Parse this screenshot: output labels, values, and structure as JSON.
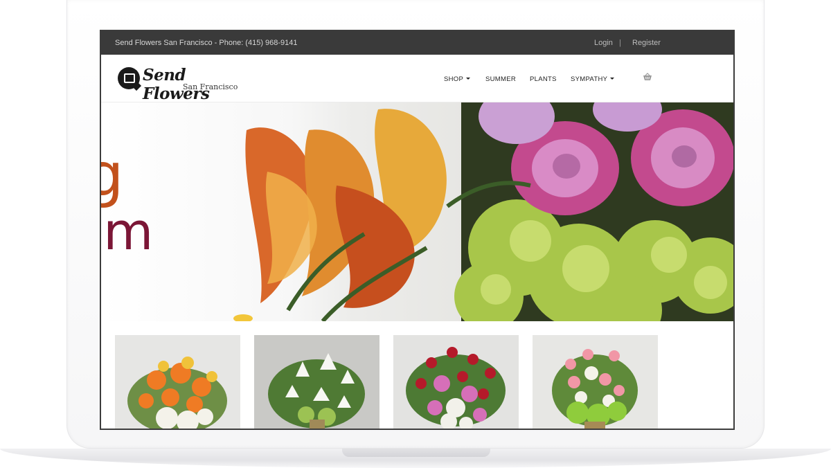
{
  "topbar": {
    "phone_text": "Send Flowers San Francisco - Phone: (415) 968-9141",
    "login": "Login",
    "separator": "|",
    "register": "Register"
  },
  "logo": {
    "title": "Send Flowers",
    "subtitle": "San Francisco"
  },
  "nav": {
    "items": [
      {
        "label": "SHOP",
        "has_dropdown": true
      },
      {
        "label": "SUMMER",
        "has_dropdown": false
      },
      {
        "label": "PLANTS",
        "has_dropdown": false
      },
      {
        "label": "SYMPATHY",
        "has_dropdown": true
      }
    ],
    "cart_icon": "basket-icon"
  },
  "hero": {
    "text_line_1": "g",
    "text_line_2": "om"
  },
  "products": [
    {
      "name": "orange-rose-bouquet",
      "image": "product-image"
    },
    {
      "name": "white-lily-bouquet",
      "image": "product-image"
    },
    {
      "name": "red-rose-lily-bouquet",
      "image": "product-image"
    },
    {
      "name": "pink-rose-hydrangea-bouquet",
      "image": "product-image"
    }
  ],
  "colors": {
    "topbar_bg": "#3a3a3a",
    "hero_orange": "#c2511c",
    "hero_plum": "#7b1636"
  }
}
